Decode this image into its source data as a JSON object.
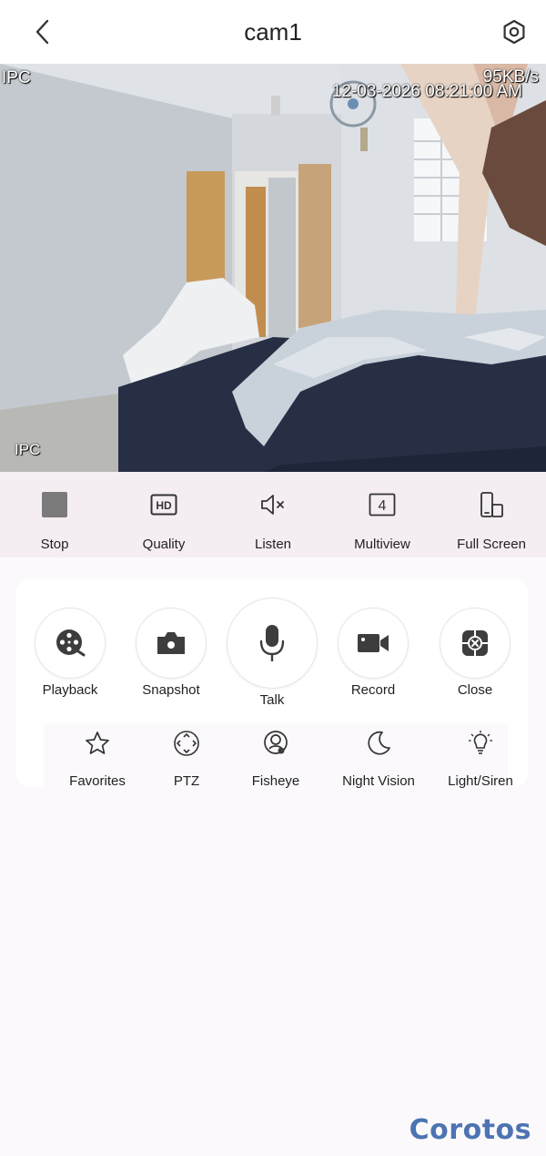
{
  "header": {
    "title": "cam1"
  },
  "video": {
    "channel_label_top": "IPC",
    "bitrate": "95KB/s",
    "timestamp": "12-03-2026 08:21:00 AM",
    "channel_label_bottom": "IPC"
  },
  "controls": [
    {
      "label": "Stop",
      "icon": "stop-icon"
    },
    {
      "label": "Quality",
      "icon": "hd-icon"
    },
    {
      "label": "Listen",
      "icon": "speaker-muted-icon"
    },
    {
      "label": "Multiview",
      "icon": "multiview-4-icon",
      "badge": "4"
    },
    {
      "label": "Full Screen",
      "icon": "rotate-fullscreen-icon"
    }
  ],
  "actions": [
    {
      "label": "Playback",
      "icon": "film-reel-icon"
    },
    {
      "label": "Snapshot",
      "icon": "camera-icon"
    },
    {
      "label": "Talk",
      "icon": "microphone-icon"
    },
    {
      "label": "Record",
      "icon": "video-camera-icon"
    },
    {
      "label": "Close",
      "icon": "close-stream-icon"
    }
  ],
  "features": [
    {
      "label": "Favorites",
      "icon": "star-icon"
    },
    {
      "label": "PTZ",
      "icon": "ptz-icon"
    },
    {
      "label": "Fisheye",
      "icon": "fisheye-icon"
    },
    {
      "label": "Night Vision",
      "icon": "moon-icon"
    },
    {
      "label": "Light/Siren",
      "icon": "light-bulb-icon"
    }
  ],
  "watermark": "Corotos",
  "colors": {
    "accent": "#4d73b2",
    "strip_bg": "#f4eef3",
    "icon_dark": "#444444"
  }
}
